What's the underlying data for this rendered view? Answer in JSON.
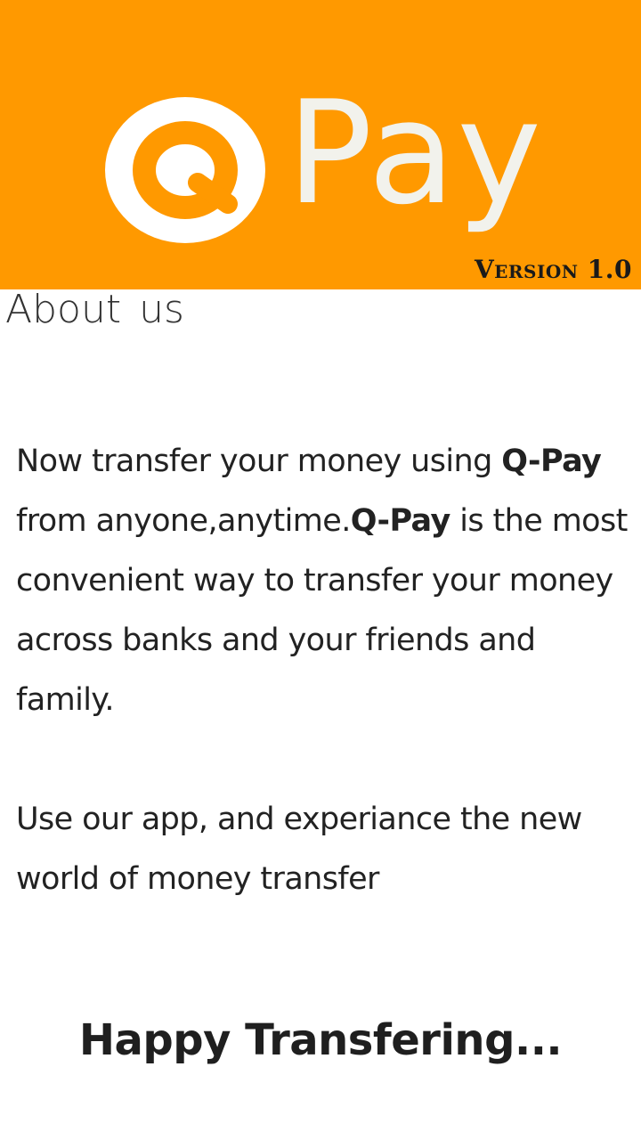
{
  "header": {
    "brand_text": "Pay",
    "version_label": "Version 1.0",
    "background_color": "#FF9900",
    "logo_icon": "q-letter-logo-icon"
  },
  "about": {
    "title": "About us",
    "para1_part1": "Now transfer your money using ",
    "para1_bold1": "Q-Pay",
    "para1_part2": " from anyone,anytime.",
    "para1_bold2": "Q-Pay",
    "para1_part3": " is the most convenient way to transfer your money across banks and your friends and family.",
    "para2": "Use our app, and experiance the new world of money transfer"
  },
  "footer": {
    "tagline": "Happy Transfering..."
  }
}
